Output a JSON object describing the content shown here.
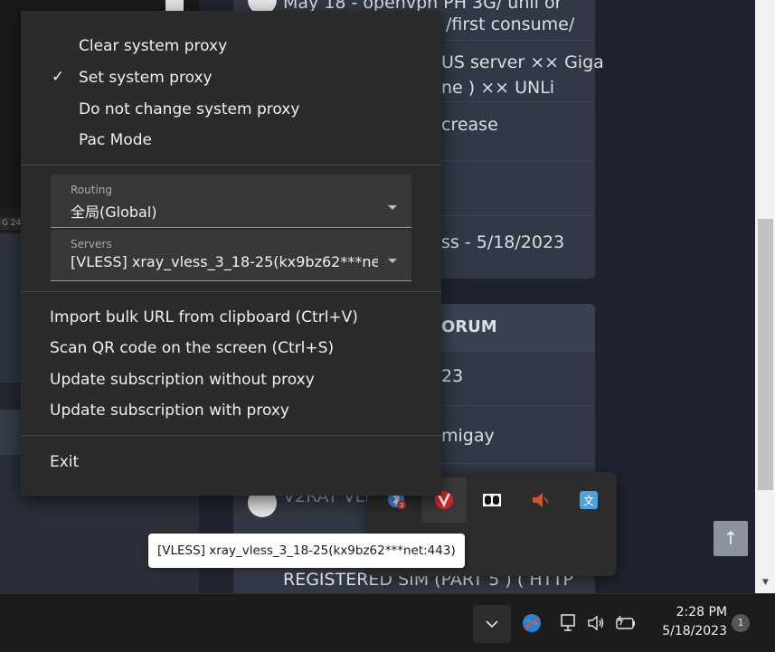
{
  "background_page": {
    "left_strip_text": "G 24",
    "card1_lines": [
      "May 18 - openvpn PH 3G/ unli or",
      "/first consume/",
      "US server ×× Giga",
      "ne ) ×× UNLi",
      "crease",
      "ss - 5/18/2023"
    ],
    "card2_header": "ORUM",
    "card2_lines": [
      "23",
      "migay",
      "V2RAY VLE",
      "REGISTERED SIM (PART 5 ) ( HTTP"
    ],
    "scroll_top_label": "↑",
    "scroll_down_label": "▼"
  },
  "context_menu": {
    "proxy_items": [
      {
        "label": "Clear system proxy",
        "checked": false
      },
      {
        "label": "Set system proxy",
        "checked": true
      },
      {
        "label": "Do not change system proxy",
        "checked": false
      },
      {
        "label": "Pac Mode",
        "checked": false
      }
    ],
    "check_mark": "✓",
    "routing": {
      "label": "Routing",
      "value": "全局(Global)"
    },
    "servers": {
      "label": "Servers",
      "value": "[VLESS] xray_vless_3_18-25(kx9bz62***net:443)"
    },
    "actions": [
      "Import bulk URL from clipboard (Ctrl+V)",
      "Scan QR code on the screen (Ctrl+S)",
      "Update subscription without proxy",
      "Update subscription with proxy"
    ],
    "exit_label": "Exit"
  },
  "tray_overflow": {
    "icons": [
      "bluetooth-app-icon",
      "v2rayn-icon",
      "dolby-icon",
      "speaker-muted-icon",
      "translate-icon"
    ],
    "badge_count": "3"
  },
  "tooltip": {
    "text": "[VLESS] xray_vless_3_18-25(kx9bz62***net:443)"
  },
  "taskbar": {
    "time": "2:28 PM",
    "date": "5/18/2023",
    "notification_count": "1"
  }
}
